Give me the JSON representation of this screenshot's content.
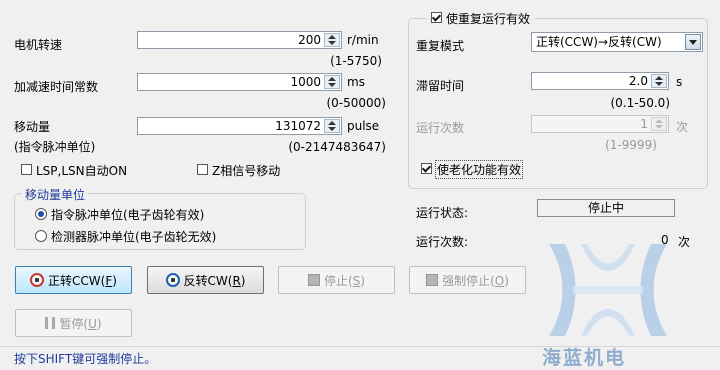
{
  "motor_speed": {
    "label": "电机转速",
    "value": "200",
    "unit": "r/min",
    "range": "(1-5750)"
  },
  "accel_time": {
    "label": "加减速时间常数",
    "value": "1000",
    "unit": "ms",
    "range": "(0-50000)"
  },
  "move_amount": {
    "label": "移动量",
    "sublabel": "(指令脉冲单位)",
    "value": "131072",
    "unit": "pulse",
    "range": "(0-2147483647)"
  },
  "checks": {
    "lsp_lsn": {
      "label": "LSP,LSN自动ON",
      "checked": false
    },
    "z_phase": {
      "label": "Z相信号移动",
      "checked": false
    }
  },
  "unit_group": {
    "title": "移动量单位",
    "options": [
      {
        "label": "指令脉冲单位(电子齿轮有效)",
        "selected": true
      },
      {
        "label": "检测器脉冲单位(电子齿轮无效)",
        "selected": false
      }
    ]
  },
  "repeat": {
    "enable_label": "使重复运行有效",
    "enabled": true,
    "mode_label": "重复模式",
    "mode_value": "正转(CCW)→反转(CW)",
    "dwell_label": "滞留时间",
    "dwell_value": "2.0",
    "dwell_unit": "s",
    "dwell_range": "(0.1-50.0)",
    "count_label": "运行次数",
    "count_value": "1",
    "count_unit": "次",
    "count_range": "(1-9999)",
    "aging_label": "使老化功能有效",
    "aging_enabled": true
  },
  "status": {
    "state_label": "运行状态:",
    "state_value": "停止中",
    "count_label": "运行次数:",
    "count_value": "0",
    "count_unit": "次"
  },
  "buttons": {
    "forward": {
      "text": "正转CCW(",
      "key": "F",
      "tail": ")"
    },
    "reverse": {
      "text": "反转CW(",
      "key": "R",
      "tail": ")"
    },
    "stop": {
      "text": "停止(",
      "key": "S",
      "tail": ")"
    },
    "force_stop": {
      "text": "强制停止(",
      "key": "O",
      "tail": ")"
    },
    "pause": {
      "text": "暂停(",
      "key": "U",
      "tail": ")"
    }
  },
  "hint": "按下SHIFT键可强制停止。",
  "watermark": "海蓝机电"
}
